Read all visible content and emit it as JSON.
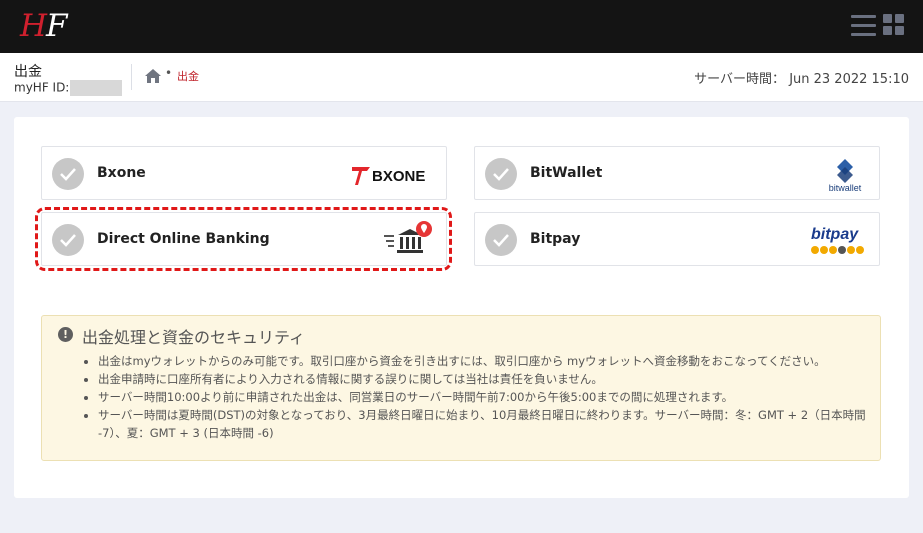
{
  "header": {
    "logo_h": "H",
    "logo_f": "F",
    "menu_icon": "hamburger-icon",
    "grid_icon": "grid-icon"
  },
  "subheader": {
    "page_title": "出金",
    "myhf_label": "myHF ID:",
    "breadcrumb": {
      "home_icon": "home-icon",
      "separator": "•",
      "current": "出金"
    },
    "server_time_label": "サーバー時間：",
    "server_time_value": "Jun 23 2022 15:10"
  },
  "methods": [
    {
      "name": "Bxone",
      "logo": "BXONE"
    },
    {
      "name": "BitWallet",
      "logo": "bitwallet"
    },
    {
      "name": "Direct Online Banking",
      "logo": "bank-icon"
    },
    {
      "name": "Bitpay",
      "logo": "bitpay"
    }
  ],
  "notice": {
    "title": "出金処理と資金のセキュリティ",
    "icon": "exclamation-icon",
    "items": [
      "出金はmyウォレットからのみ可能です。取引口座から資金を引き出すには、取引口座から myウォレットへ資金移動をおこなってください。",
      "出金申請時に口座所有者により入力される情報に関する誤りに関しては当社は責任を負いません。",
      "サーバー時間10:00より前に申請された出金は、同営業日のサーバー時間午前7:00から午後5:00までの間に処理されます。",
      "サーバー時間は夏時間(DST)の対象となっており、3月最終日曜日に始まり、10月最終日曜日に終わります。サーバー時間：冬：GMT + 2（日本時間 -7）、夏：GMT + 3 (日本時間 -6)"
    ]
  },
  "colors": {
    "brand_red": "#d0202e",
    "highlight": "#e01818",
    "notice_bg": "#fdf7e3"
  }
}
